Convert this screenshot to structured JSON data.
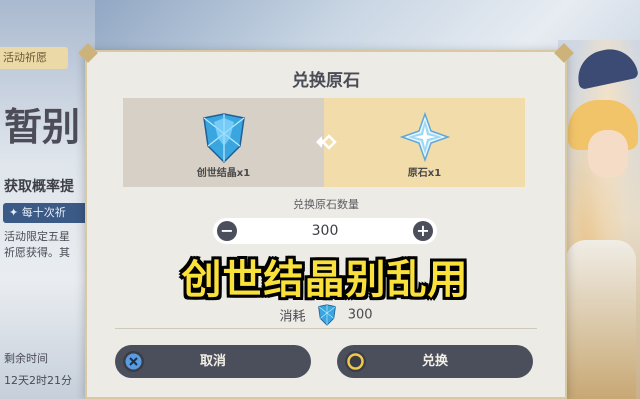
{
  "background": {
    "event_tab": "活动祈愿",
    "banner_title": "暂别",
    "probability_heading": "获取概率提",
    "highlight_pill": "每十次祈",
    "desc_line1": "活动限定五星",
    "desc_line2": "祈愿获得。其",
    "remaining_label": "剩余时间",
    "remaining_value": "12天2时21分"
  },
  "dialog": {
    "title": "兑换原石",
    "from_item": {
      "label": "创世结晶x1",
      "icon": "genesis-crystal-icon"
    },
    "to_item": {
      "label": "原石x1",
      "icon": "primogem-icon"
    },
    "arrow_icon": "exchange-arrow-icon",
    "quantity_label": "兑换原石数量",
    "quantity_value": "300",
    "minus": "−",
    "plus": "+",
    "cost_label": "消耗",
    "cost_value": "300",
    "cancel_label": "取消",
    "confirm_label": "兑换"
  },
  "caption": "创世结晶别乱用",
  "colors": {
    "panel_left": "#d6d0c6",
    "panel_right": "#f2dcaa",
    "button_dark": "#4b4f5c",
    "caption_yellow": "#f9e03a",
    "cancel_icon": "#5b9be0",
    "confirm_icon": "#f0c94a"
  }
}
